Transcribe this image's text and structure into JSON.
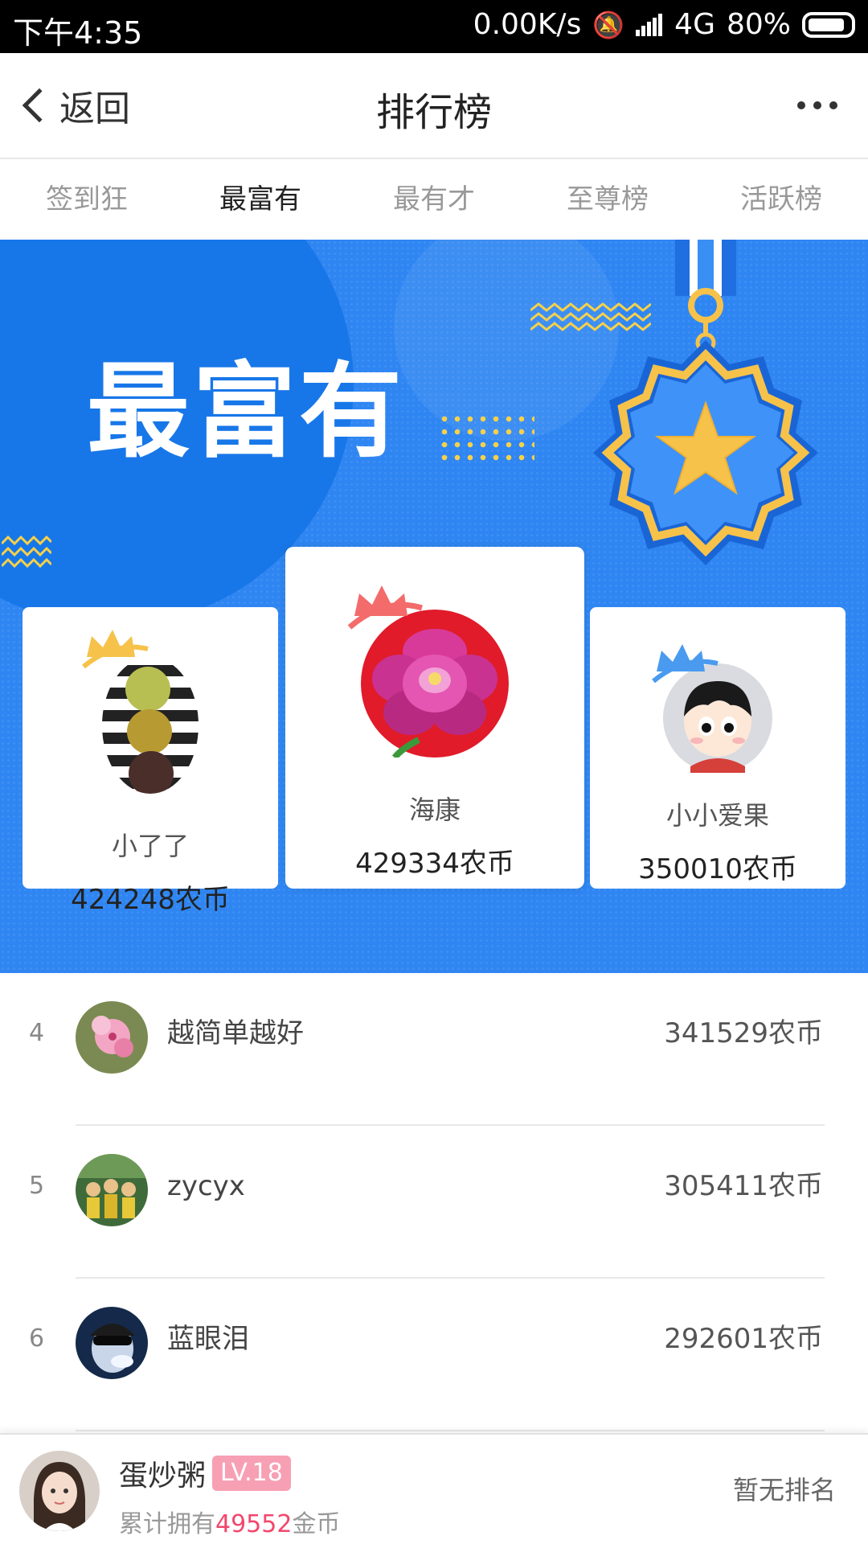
{
  "status_bar": {
    "time": "下午4:35",
    "network_speed": "0.00K/s",
    "network_type": "4G",
    "battery": "80%"
  },
  "navbar": {
    "back_label": "返回",
    "title": "排行榜"
  },
  "tabs": [
    "签到狂",
    "最富有",
    "最有才",
    "至尊榜",
    "活跃榜"
  ],
  "active_tab": "最富有",
  "banner": {
    "title": "最富有"
  },
  "podium": {
    "first": {
      "name": "海康",
      "score": "429334农币"
    },
    "second": {
      "name": "小了了",
      "score": "424248农币"
    },
    "third": {
      "name": "小小爱果",
      "score": "350010农币"
    }
  },
  "ranking": [
    {
      "rank": "4",
      "name": "越简单越好",
      "score": "341529农币"
    },
    {
      "rank": "5",
      "name": "zycyx",
      "score": "305411农币"
    },
    {
      "rank": "6",
      "name": "蓝眼泪",
      "score": "292601农币"
    }
  ],
  "me": {
    "name": "蛋炒粥",
    "level": "LV.18",
    "summary_prefix": "累计拥有",
    "coins": "49552",
    "summary_suffix": "金币",
    "rank_status": "暂无排名"
  },
  "colors": {
    "banner_blue": "#2f86f2",
    "gold": "#f7c24a",
    "accent_pink": "#f2476e",
    "crown_red": "#f36b6b",
    "crown_blue": "#4a9bf0"
  }
}
